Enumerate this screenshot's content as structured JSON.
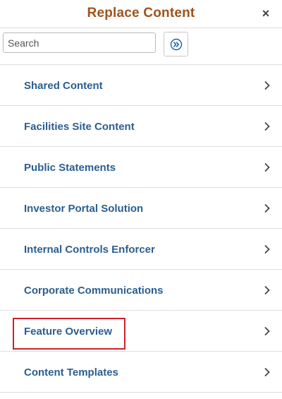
{
  "header": {
    "title": "Replace Content",
    "close_glyph": "×"
  },
  "search": {
    "placeholder": "Search",
    "value": "",
    "go_icon": "double-chevron-right-icon"
  },
  "colors": {
    "title": "#a0521e",
    "item_label": "#2b5e91",
    "highlight": "#d0202a",
    "go_icon": "#1f5fa8"
  },
  "items": [
    {
      "label": "Shared Content"
    },
    {
      "label": "Facilities Site Content"
    },
    {
      "label": "Public Statements"
    },
    {
      "label": "Investor Portal Solution"
    },
    {
      "label": "Internal Controls Enforcer"
    },
    {
      "label": "Corporate Communications"
    },
    {
      "label": "Feature Overview",
      "highlighted": true
    },
    {
      "label": "Content Templates"
    }
  ]
}
